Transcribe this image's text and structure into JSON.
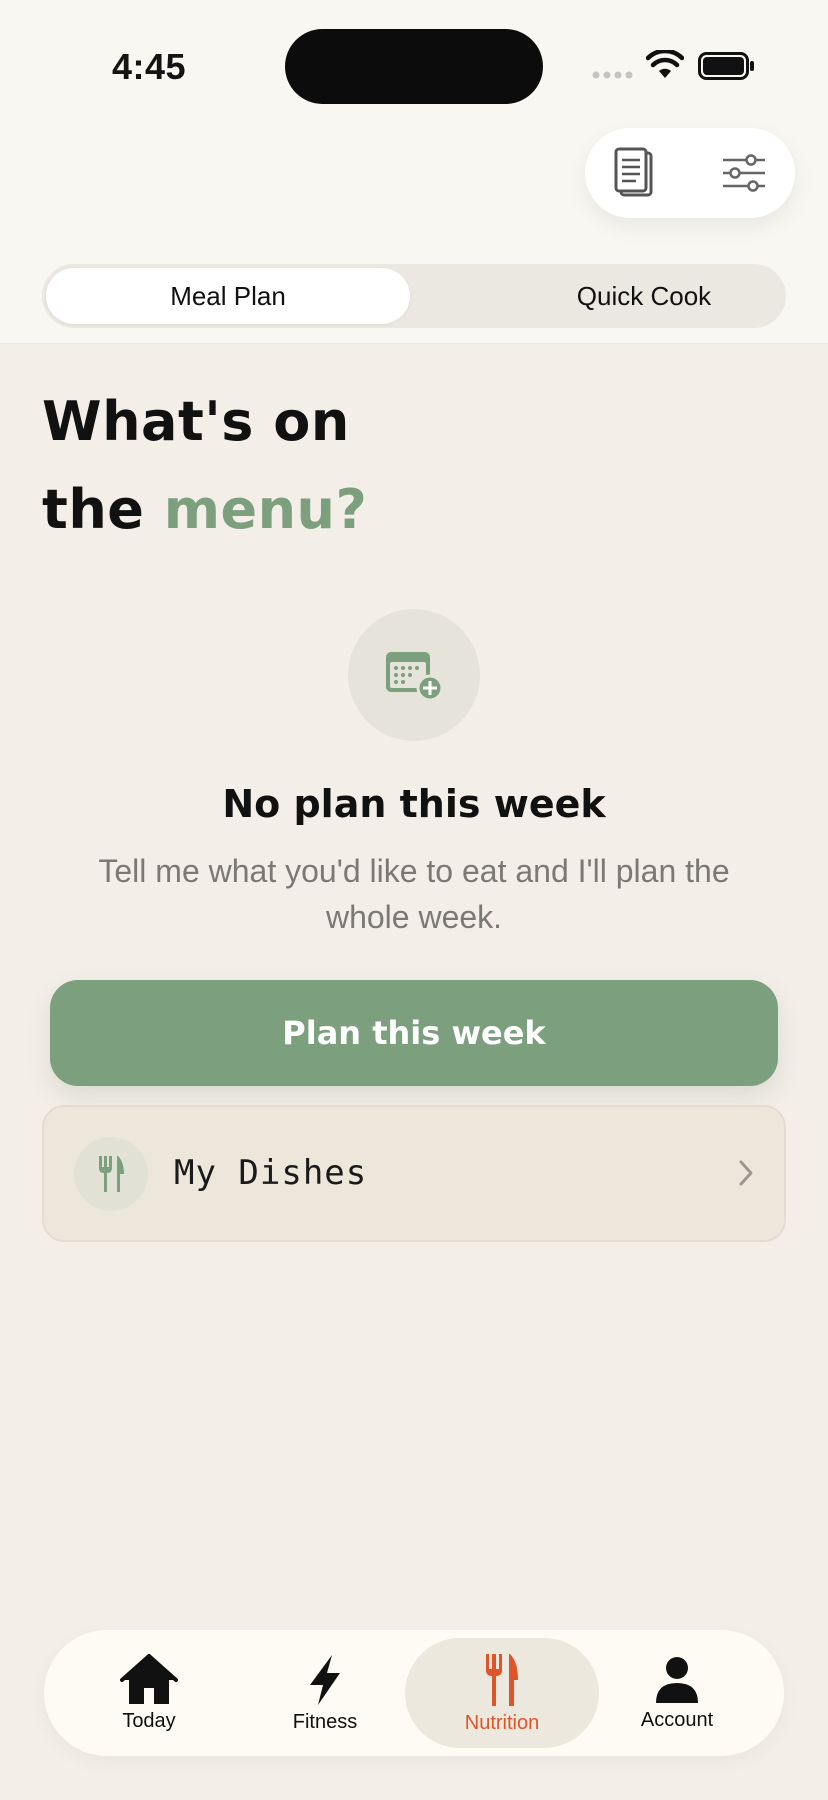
{
  "status_bar": {
    "time": "4:45"
  },
  "toolbar": {
    "icons": [
      "recipe-book-icon",
      "filter-sliders-icon"
    ]
  },
  "segments": {
    "meal_plan": "Meal Plan",
    "quick_cook": "Quick Cook",
    "selected": "Meal Plan"
  },
  "headline": {
    "line1": "What's on",
    "line2_prefix": "the ",
    "line2_accent": "menu?"
  },
  "empty_state": {
    "icon": "calendar-add-icon",
    "title": "No plan this week",
    "description": "Tell me what you'd like to eat and I'll plan the whole week."
  },
  "primary_button": {
    "label": "Plan this week"
  },
  "my_dishes": {
    "label": "My Dishes",
    "icon": "fork-knife-icon"
  },
  "tabs": [
    {
      "label": "Today",
      "icon": "house-icon"
    },
    {
      "label": "Fitness",
      "icon": "bolt-icon"
    },
    {
      "label": "Nutrition",
      "icon": "fork-knife-icon",
      "active": true
    },
    {
      "label": "Account",
      "icon": "person-icon"
    }
  ],
  "colors": {
    "accent_green": "#7c9f7e",
    "active_tab": "#e0542a",
    "background": "#f3efe8"
  }
}
